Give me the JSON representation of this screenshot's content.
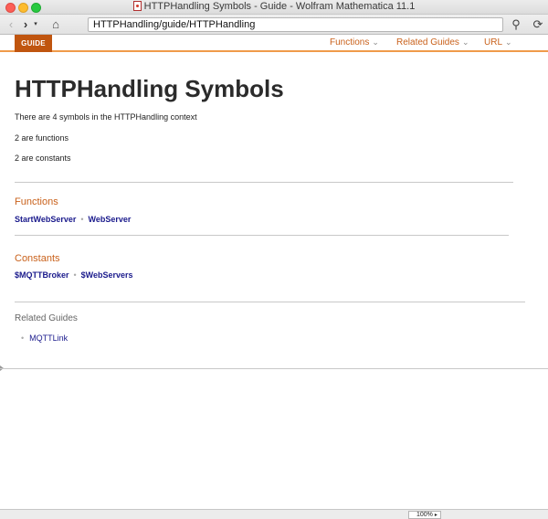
{
  "window": {
    "title": "HTTPHandling Symbols - Guide - Wolfram Mathematica 11.1"
  },
  "toolbar": {
    "back_icon": "‹",
    "forward_icon": "›",
    "dropdown_icon": "▾",
    "home_icon": "⌂",
    "url": "HTTPHandling/guide/HTTPHandling",
    "search_icon": "⚲",
    "refresh_icon": "⟳"
  },
  "header": {
    "badge": "GUIDE",
    "menus": [
      {
        "label": "Functions"
      },
      {
        "label": "Related Guides"
      },
      {
        "label": "URL"
      }
    ],
    "chevron": "⌄"
  },
  "content": {
    "title": "HTTPHandling Symbols",
    "summary": [
      "There are 4 symbols in the HTTPHandling context",
      "2 are functions",
      "2 are constants"
    ],
    "sections": [
      {
        "title": "Functions",
        "links": [
          "StartWebServer",
          "WebServer"
        ]
      },
      {
        "title": "Constants",
        "links": [
          "$MQTTBroker",
          "$WebServers"
        ]
      }
    ],
    "separator": "•",
    "related_guides": {
      "title": "Related Guides",
      "items": [
        "MQTTLink"
      ]
    }
  },
  "status": {
    "zoom": "100%",
    "zoom_arrow": "▸"
  },
  "colors": {
    "accent": "#c9611b",
    "badge": "#c0550f",
    "link": "#1a1a8c",
    "header_rule": "#f09b4a"
  }
}
